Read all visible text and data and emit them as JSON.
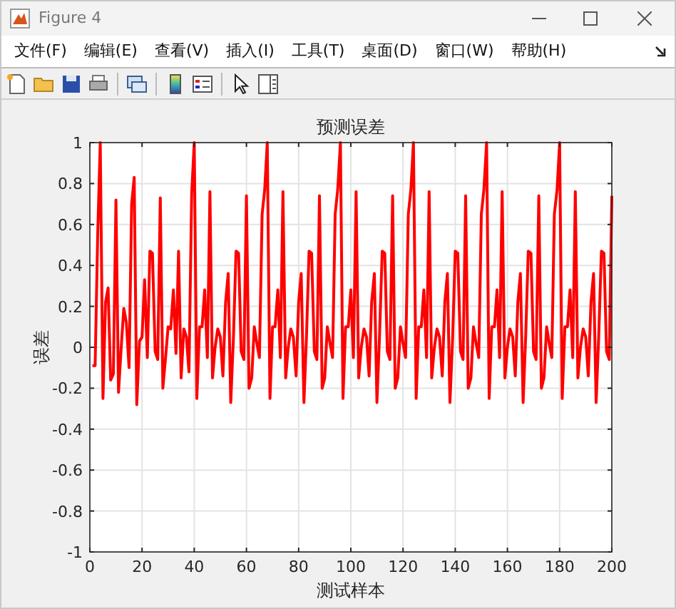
{
  "window": {
    "title": "Figure 4"
  },
  "menu": [
    "文件(F)",
    "编辑(E)",
    "查看(V)",
    "插入(I)",
    "工具(T)",
    "桌面(D)",
    "窗口(W)",
    "帮助(H)"
  ],
  "toolbar": [
    {
      "kind": "new"
    },
    {
      "kind": "open"
    },
    {
      "kind": "save"
    },
    {
      "kind": "print"
    },
    {
      "kind": "separator"
    },
    {
      "kind": "link"
    },
    {
      "kind": "separator"
    },
    {
      "kind": "colorbar"
    },
    {
      "kind": "legend"
    },
    {
      "kind": "separator"
    },
    {
      "kind": "pointer"
    },
    {
      "kind": "panel"
    }
  ],
  "chart_data": {
    "type": "line",
    "title": "预测误差",
    "xlabel": "测试样本",
    "ylabel": "误差",
    "xlim": [
      0,
      200
    ],
    "ylim": [
      -1,
      1
    ],
    "grid": true,
    "xticks": [
      0,
      20,
      40,
      60,
      80,
      100,
      120,
      140,
      160,
      180,
      200
    ],
    "yticks": [
      -1,
      -0.8,
      -0.6,
      -0.4,
      -0.2,
      0,
      0.2,
      0.4,
      0.6,
      0.8,
      1
    ],
    "x": [
      1,
      2,
      3,
      4,
      5,
      6,
      7,
      8,
      9,
      10,
      11,
      12,
      13,
      14,
      15,
      16,
      17,
      18,
      19,
      20,
      21,
      22,
      23,
      24,
      25,
      26,
      27,
      28,
      29,
      30,
      31,
      32,
      33,
      34,
      35,
      36,
      37,
      38,
      39,
      40,
      41,
      42,
      43,
      44,
      45,
      46,
      47,
      48,
      49,
      50,
      51,
      52,
      53,
      54,
      55,
      56,
      57,
      58,
      59,
      60,
      61,
      62,
      63,
      64,
      65,
      66,
      67,
      68,
      69,
      70,
      71,
      72,
      73,
      74,
      75,
      76,
      77,
      78,
      79,
      80,
      81,
      82,
      83,
      84,
      85,
      86,
      87,
      88,
      89,
      90,
      91,
      92,
      93,
      94,
      95,
      96,
      97,
      98,
      99,
      100,
      101,
      102,
      103,
      104,
      105,
      106,
      107,
      108,
      109,
      110,
      111,
      112,
      113,
      114,
      115,
      116,
      117,
      118,
      119,
      120,
      121,
      122,
      123,
      124,
      125,
      126,
      127,
      128,
      129,
      130,
      131,
      132,
      133,
      134,
      135,
      136,
      137,
      138,
      139,
      140,
      141,
      142,
      143,
      144,
      145,
      146,
      147,
      148,
      149,
      150,
      151,
      152,
      153,
      154,
      155,
      156,
      157,
      158,
      159,
      160,
      161,
      162,
      163,
      164,
      165,
      166,
      167,
      168,
      169,
      170,
      171,
      172,
      173,
      174,
      175,
      176,
      177,
      178,
      179,
      180,
      181,
      182,
      183,
      184,
      185,
      186,
      187,
      188,
      189,
      190,
      191,
      192,
      193,
      194,
      195,
      196,
      197,
      198,
      199,
      200
    ],
    "series": [
      {
        "color": "#ff0000",
        "values": [
          -0.09,
          -0.09,
          0.55,
          1,
          -0.25,
          0.22,
          0.29,
          -0.16,
          -0.13,
          0.72,
          -0.22,
          0,
          0.19,
          0.12,
          -0.1,
          0.7,
          0.83,
          -0.28,
          0.03,
          0.05,
          0.33,
          -0.05,
          0.47,
          0.46,
          -0.02,
          -0.06,
          0.73,
          -0.2,
          -0.05,
          0.1,
          0.09,
          0.28,
          -0.03,
          0.47,
          -0.15,
          0.09,
          0.05,
          -0.12,
          0.75,
          1,
          -0.25,
          0.1,
          0.1,
          0.28,
          -0.05,
          0.76,
          -0.15,
          0,
          0.09,
          0.05,
          -0.14,
          0.22,
          0.36,
          -0.27,
          0.05,
          0.47,
          0.46,
          -0.02,
          -0.06,
          0.74,
          -0.2,
          -0.15,
          0.1,
          0.02,
          -0.05,
          0.65,
          0.77,
          1,
          -0.25,
          0.1,
          0.1,
          0.28,
          -0.05,
          0.76,
          -0.15,
          0,
          0.09,
          0.05,
          -0.14,
          0.22,
          0.36,
          -0.27,
          0.05,
          0.47,
          0.46,
          -0.02,
          -0.06,
          0.74,
          -0.2,
          -0.15,
          0.1,
          0.02,
          -0.05,
          0.65,
          0.77,
          1,
          -0.25,
          0.1,
          0.1,
          0.28,
          -0.05,
          0.76,
          -0.15,
          0,
          0.09,
          0.05,
          -0.14,
          0.22,
          0.36,
          -0.27,
          0.05,
          0.47,
          0.46,
          -0.02,
          -0.06,
          0.74,
          -0.2,
          -0.15,
          0.1,
          0.02,
          -0.05,
          0.65,
          0.77,
          1,
          -0.25,
          0.1,
          0.1,
          0.28,
          -0.05,
          0.76,
          -0.15,
          0,
          0.09,
          0.05,
          -0.14,
          0.22,
          0.36,
          -0.27,
          0.05,
          0.47,
          0.46,
          -0.02,
          -0.06,
          0.74,
          -0.2,
          -0.15,
          0.1,
          0.02,
          -0.05,
          0.65,
          0.77,
          1,
          -0.25,
          0.1,
          0.1,
          0.28,
          -0.05,
          0.76,
          -0.15,
          0,
          0.09,
          0.05,
          -0.14,
          0.22,
          0.36,
          -0.27,
          0.05,
          0.47,
          0.46,
          -0.02,
          -0.06,
          0.74,
          -0.2,
          -0.15,
          0.1,
          0.02,
          -0.05,
          0.65,
          0.77,
          1,
          -0.25,
          0.1,
          0.1,
          0.28,
          -0.05,
          0.76,
          -0.15,
          0,
          0.09,
          0.05,
          -0.14,
          0.22,
          0.36,
          -0.27,
          0.05,
          0.47,
          0.46,
          -0.02,
          -0.06,
          0.74
        ]
      }
    ]
  }
}
